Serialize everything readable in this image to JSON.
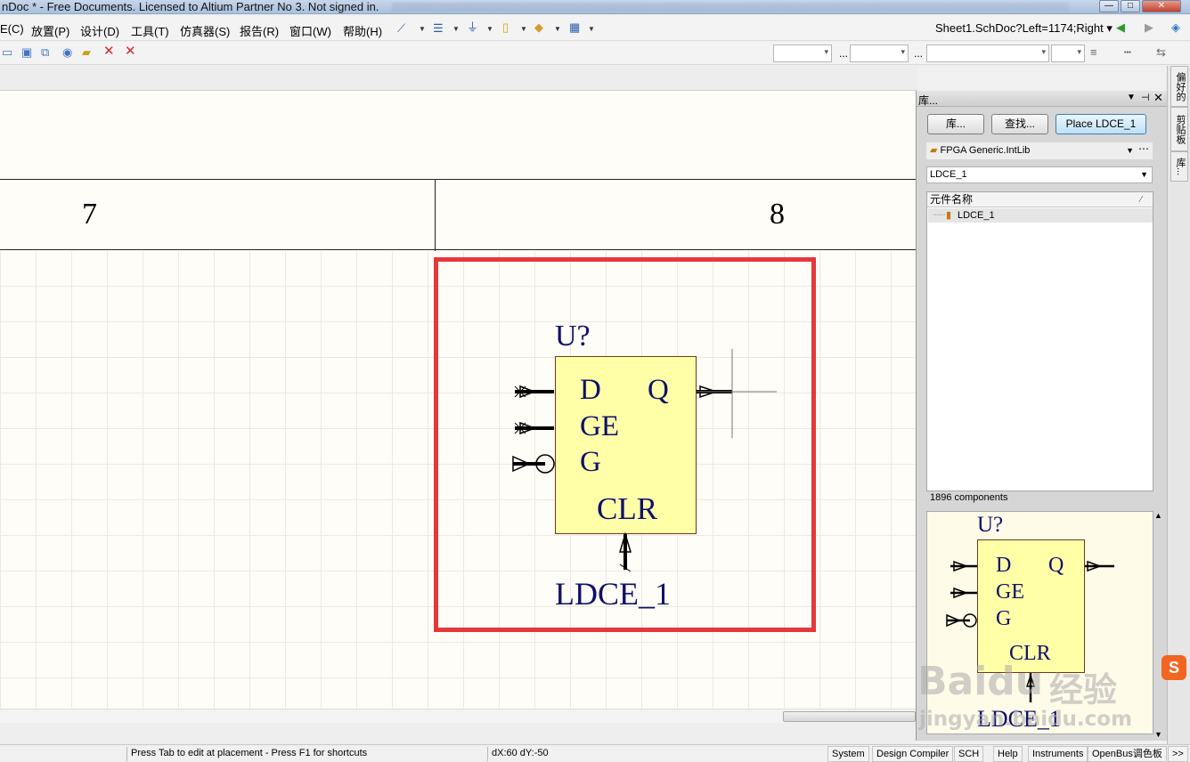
{
  "window": {
    "title": "nDoc * - Free Documents. Licensed to Altium Partner No 3. Not signed in.",
    "buttons": [
      "—",
      "□",
      "✕"
    ]
  },
  "menu": {
    "items": [
      "E(C)",
      "放置(P)",
      "设计(D)",
      "工具(T)",
      "仿真器(S)",
      "报告(R)",
      "窗口(W)",
      "帮助(H)"
    ],
    "path_combo": "Sheet1.SchDoc?Left=1174;Right ▾",
    "ellipsis": "..."
  },
  "sheet": {
    "zone_left": "7",
    "zone_right": "8"
  },
  "component": {
    "designator": "U?",
    "name": "LDCE_1",
    "pins": {
      "d": "D",
      "ge": "GE",
      "g": "G",
      "clr": "CLR",
      "q": "Q"
    }
  },
  "library_panel": {
    "title": "库...",
    "buttons": {
      "libraries": "库...",
      "search": "查找...",
      "place": "Place LDCE_1"
    },
    "library": "FPGA Generic.IntLib",
    "filter": "LDCE_1",
    "column_header": "元件名称",
    "items": [
      "LDCE_1"
    ],
    "count": "1896 components"
  },
  "dock_tabs": [
    "偏好的",
    "剪贴板",
    "库..."
  ],
  "status": {
    "hint": "Press Tab to edit at placement - Press F1 for shortcuts",
    "coords": "dX:60 dY:-50",
    "buttons": [
      "System",
      "Design Compiler",
      "SCH",
      "Help",
      "Instruments",
      "OpenBus调色板",
      ">>"
    ]
  },
  "watermark": {
    "brand": "Baidu",
    "cn": "经验",
    "url": "jingyan.baidu.com"
  }
}
